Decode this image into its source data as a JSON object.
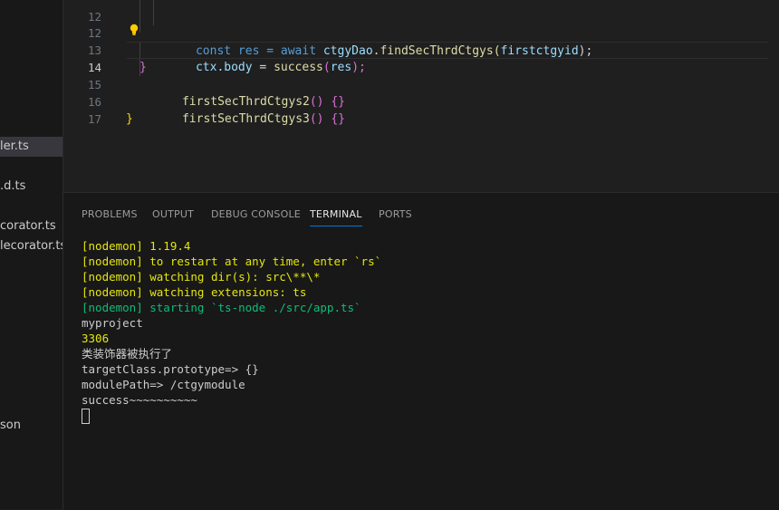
{
  "explorer": {
    "items": [
      {
        "label": "ler.ts",
        "selected": true
      },
      {
        "label": ".d.ts",
        "selected": false
      },
      {
        "label": "corator.ts",
        "selected": false
      },
      {
        "label": "lecorator.ts",
        "selected": false
      },
      {
        "label": "son",
        "selected": false
      }
    ]
  },
  "editor": {
    "lines": [
      {
        "num": "12",
        "t1": "const res = await ",
        "t2": "ctgyDao",
        "t3": ".findSecThrdCtgys(",
        "t4": "firstctgyid",
        "t5": ");"
      },
      {
        "num": "12",
        "t1": "ctx",
        "t2": ".body",
        "t3": " = ",
        "t4": "success",
        "t5": "(",
        "t6": "res",
        "t7": ");"
      },
      {
        "num": "13",
        "brace": "}"
      },
      {
        "num": "14",
        "fn": "firstSecThrdCtgys2",
        "parens": "()",
        "braces": "{}"
      },
      {
        "num": "15",
        "fn": "firstSecThrdCtgys3",
        "parens": "()",
        "braces": "{}"
      },
      {
        "num": "16",
        "brace": "}"
      },
      {
        "num": "17"
      }
    ]
  },
  "panel": {
    "tabs": [
      "PROBLEMS",
      "OUTPUT",
      "DEBUG CONSOLE",
      "TERMINAL",
      "PORTS"
    ],
    "active_tab": "TERMINAL"
  },
  "terminal": {
    "lines": [
      {
        "text": "[nodemon] 1.19.4",
        "color": "yellow"
      },
      {
        "text": "[nodemon] to restart at any time, enter `rs`",
        "color": "yellow"
      },
      {
        "text": "[nodemon] watching dir(s): src\\**\\*",
        "color": "yellow"
      },
      {
        "text": "[nodemon] watching extensions: ts",
        "color": "yellow"
      },
      {
        "text": "[nodemon] starting `ts-node ./src/app.ts`",
        "color": "green"
      },
      {
        "text": "myproject",
        "color": "white"
      },
      {
        "text": "3306",
        "color": "yellow"
      },
      {
        "text": "类装饰器被执行了",
        "color": "white"
      },
      {
        "text": "targetClass.prototype=> {}",
        "color": "white"
      },
      {
        "text": "modulePath=> /ctgymodule",
        "color": "white"
      },
      {
        "text": "success~~~~~~~~~~",
        "color": "white"
      }
    ]
  },
  "colors": {
    "accent": "#0078d4",
    "terminal_yellow": "#e5e510",
    "terminal_green": "#0dbc79"
  }
}
